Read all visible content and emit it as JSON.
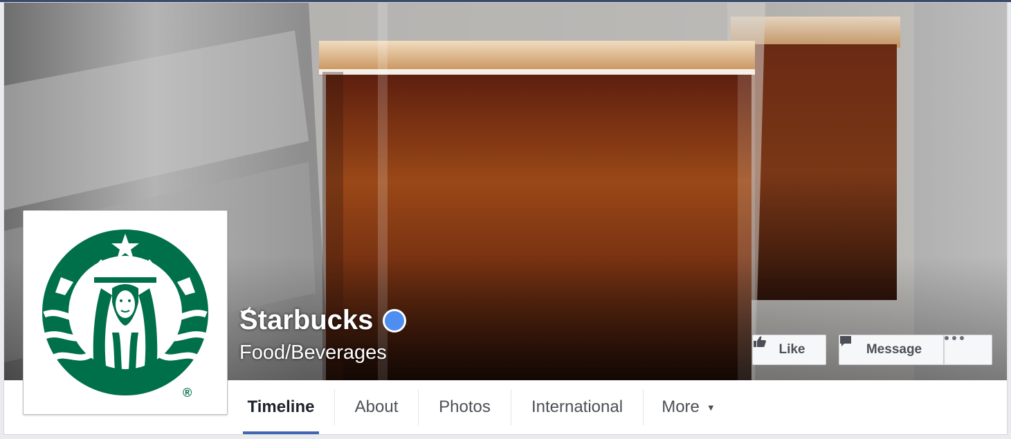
{
  "page": {
    "name": "Starbucks",
    "category": "Food/Beverages",
    "verified_icon": "verified-check-icon",
    "logo_registered_mark": "®"
  },
  "actions": {
    "like_label": "Like",
    "message_label": "Message",
    "more_icon": "ellipsis-icon"
  },
  "tabs": [
    {
      "label": "Timeline",
      "active": true
    },
    {
      "label": "About"
    },
    {
      "label": "Photos"
    },
    {
      "label": "International"
    },
    {
      "label": "More",
      "dropdown": true
    }
  ],
  "colors": {
    "brand_green": "#00704a",
    "tab_active_underline": "#4267b2",
    "verified_blue": "#4d8ef0"
  }
}
